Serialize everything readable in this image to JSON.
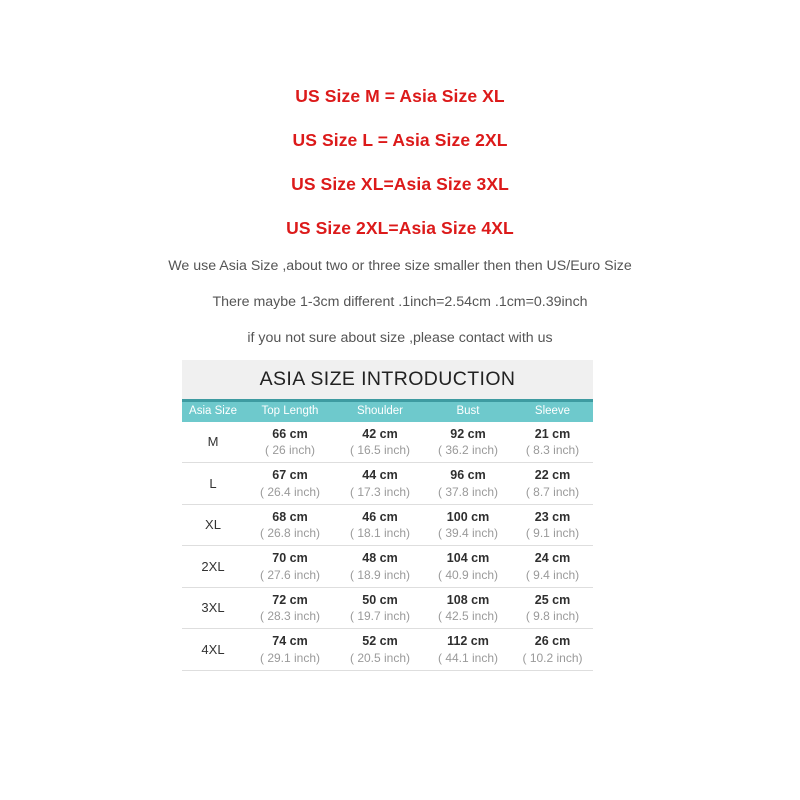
{
  "conversion_notes": [
    "US Size M = Asia Size XL",
    "US Size L = Asia Size 2XL",
    "US Size XL=Asia Size 3XL",
    "US Size 2XL=Asia Size 4XL"
  ],
  "info_notes": [
    "We use Asia Size ,about two or three size smaller then then US/Euro Size",
    "There maybe 1-3cm different .1inch=2.54cm .1cm=0.39inch",
    "if you not sure about size ,please contact with us"
  ],
  "table": {
    "title": "ASIA SIZE INTRODUCTION",
    "columns": [
      "Asia Size",
      "Top Length",
      "Shoulder",
      "Bust",
      "Sleeve"
    ],
    "rows": [
      {
        "size": "M",
        "top_length_cm": "66 cm",
        "top_length_inch": "( 26 inch)",
        "shoulder_cm": "42 cm",
        "shoulder_inch": "( 16.5 inch)",
        "bust_cm": "92 cm",
        "bust_inch": "( 36.2 inch)",
        "sleeve_cm": "21 cm",
        "sleeve_inch": "( 8.3 inch)"
      },
      {
        "size": "L",
        "top_length_cm": "67 cm",
        "top_length_inch": "( 26.4 inch)",
        "shoulder_cm": "44 cm",
        "shoulder_inch": "( 17.3 inch)",
        "bust_cm": "96 cm",
        "bust_inch": "( 37.8 inch)",
        "sleeve_cm": "22 cm",
        "sleeve_inch": "( 8.7 inch)"
      },
      {
        "size": "XL",
        "top_length_cm": "68 cm",
        "top_length_inch": "( 26.8 inch)",
        "shoulder_cm": "46 cm",
        "shoulder_inch": "( 18.1 inch)",
        "bust_cm": "100 cm",
        "bust_inch": "( 39.4 inch)",
        "sleeve_cm": "23 cm",
        "sleeve_inch": "( 9.1 inch)"
      },
      {
        "size": "2XL",
        "top_length_cm": "70 cm",
        "top_length_inch": "( 27.6 inch)",
        "shoulder_cm": "48 cm",
        "shoulder_inch": "( 18.9 inch)",
        "bust_cm": "104 cm",
        "bust_inch": "( 40.9 inch)",
        "sleeve_cm": "24 cm",
        "sleeve_inch": "( 9.4 inch)"
      },
      {
        "size": "3XL",
        "top_length_cm": "72 cm",
        "top_length_inch": "( 28.3 inch)",
        "shoulder_cm": "50 cm",
        "shoulder_inch": "( 19.7 inch)",
        "bust_cm": "108 cm",
        "bust_inch": "( 42.5 inch)",
        "sleeve_cm": "25 cm",
        "sleeve_inch": "( 9.8 inch)"
      },
      {
        "size": "4XL",
        "top_length_cm": "74 cm",
        "top_length_inch": "( 29.1 inch)",
        "shoulder_cm": "52 cm",
        "shoulder_inch": "( 20.5 inch)",
        "bust_cm": "112 cm",
        "bust_inch": "( 44.1 inch)",
        "sleeve_cm": "26 cm",
        "sleeve_inch": "( 10.2 inch)"
      }
    ]
  },
  "colors": {
    "note_red": "#dc1a1a",
    "note_gray": "#555555",
    "header_teal": "#6ec9cc",
    "header_teal_top_border": "#3e9ba1",
    "title_background": "#f0f0f0",
    "value_dark": "#2f2f2f",
    "value_light": "#9a9a9a",
    "row_divider": "#dedede"
  }
}
